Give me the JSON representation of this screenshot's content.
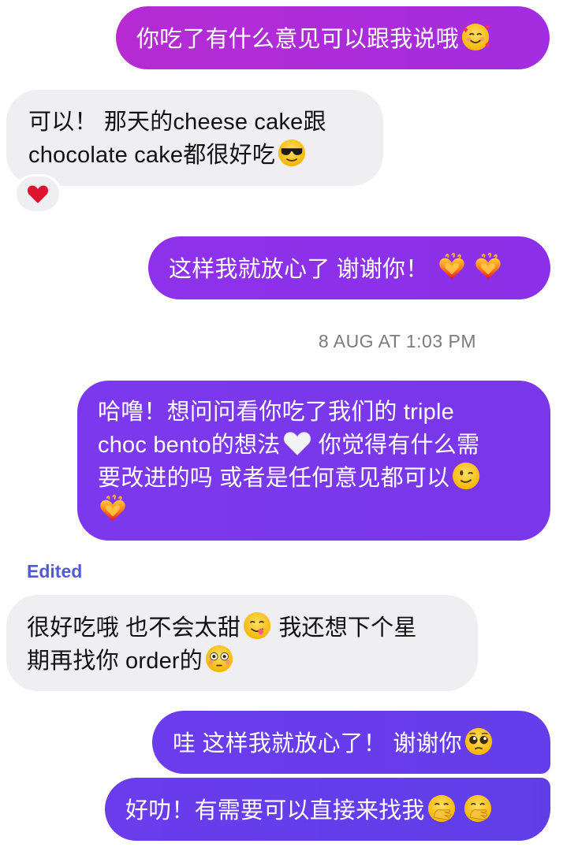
{
  "messages": [
    {
      "text": "你吃了有什么意见可以跟我说哦",
      "emojis": [
        "smiling-face-with-hearts"
      ]
    },
    {
      "line1": "可以！ 那天的cheese cake跟",
      "line2": "chocolate cake都很好吃",
      "emojis": [
        "smiling-face-with-sunglasses"
      ],
      "reaction": "red-heart"
    },
    {
      "text": "这样我就放心了 谢谢你！ ",
      "emojis": [
        "heart-on-fire",
        "heart-on-fire"
      ]
    },
    {
      "line1": "哈噜！想问问看你吃了我们的 triple",
      "line2a": "choc bento的想法",
      "line2b": " 你觉得有什么需",
      "line3": "要改进的吗 或者是任何意见都可以",
      "emojis": [
        "white-heart",
        "winking-face",
        "heart-on-fire"
      ]
    },
    {
      "line1": "很好吃哦 也不会太甜",
      "line1b": " 我还想下个星",
      "line2": "期再找你 order的",
      "emojis": [
        "face-savoring-food",
        "flushed-face"
      ]
    },
    {
      "text": "哇 这样我就放心了！ 谢谢你",
      "emojis": [
        "pleading-face"
      ]
    },
    {
      "text": "好叻！有需要可以直接来找我",
      "emojis": [
        "face-with-hand-over-mouth",
        "face-with-hand-over-mouth"
      ]
    }
  ],
  "timestamp": "8 AUG AT 1:03 PM",
  "edited_label": "Edited",
  "colors": {
    "incoming_bg": "#efeff1",
    "outgoing_top": "#b62bd2",
    "outgoing_bottom": "#5f3ee8",
    "edited": "#4f5bd5",
    "timestamp": "#7a7a80"
  }
}
